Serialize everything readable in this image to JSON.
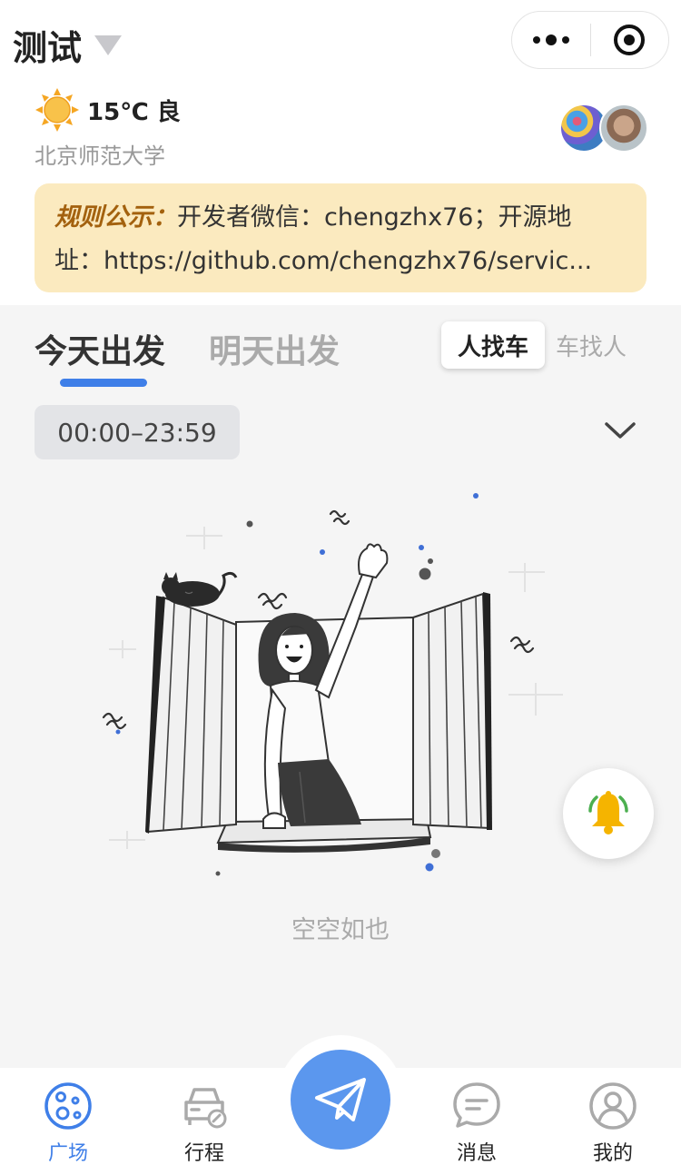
{
  "header": {
    "title": "测试"
  },
  "weather": {
    "temp_text": "15℃ 良",
    "location": "北京师范大学"
  },
  "notice": {
    "label": "规则公示：",
    "line1_text": "开发者微信：chengzhx76；开源地",
    "line2_text": "址：https://github.com/chengzhx76/servic..."
  },
  "tabs": {
    "today": "今天出发",
    "tomorrow": "明天出发"
  },
  "mode": {
    "active": "人找车",
    "inactive": "车找人"
  },
  "time_filter": {
    "range": "00:00–23:59"
  },
  "empty_state": {
    "text": "空空如也"
  },
  "tabbar": {
    "items": [
      {
        "label": "广场",
        "active": true
      },
      {
        "label": "行程",
        "active": false
      },
      {
        "label": "消息",
        "active": false
      },
      {
        "label": "我的",
        "active": false
      }
    ]
  },
  "colors": {
    "accent": "#3f7fe8",
    "notice_bg": "#fbeabf",
    "notice_label": "#a3610e",
    "publish": "#5b97ee",
    "bell": "#f5b400"
  }
}
